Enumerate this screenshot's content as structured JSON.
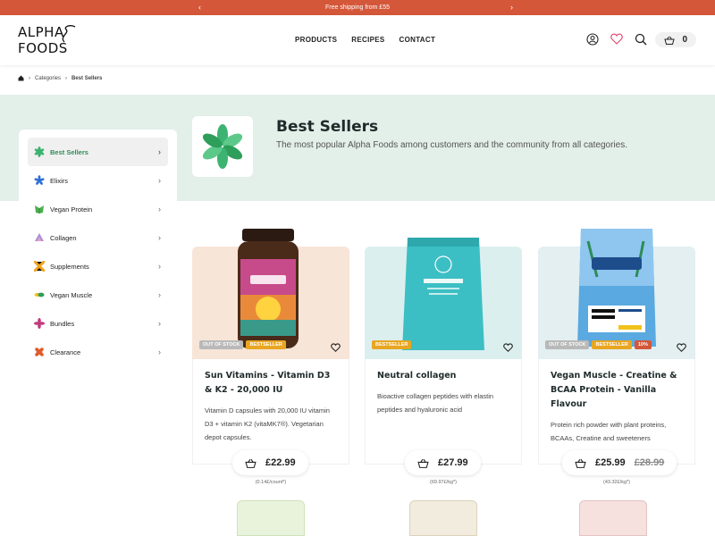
{
  "promo": {
    "text": "Free shipping from £55"
  },
  "brand": {
    "logo_text": "ALPHA FOODS"
  },
  "nav": [
    "PRODUCTS",
    "RECIPES",
    "CONTACT"
  ],
  "cart": {
    "count": "0"
  },
  "breadcrumb": {
    "home_icon": "home-icon",
    "items": [
      "Categories",
      "Best Sellers"
    ]
  },
  "sidebar": {
    "items": [
      {
        "label": "Best Sellers",
        "icon": "best-sellers-icon",
        "color": "#3cb371"
      },
      {
        "label": "Elixirs",
        "icon": "elixirs-icon",
        "color": "#2f6fd6"
      },
      {
        "label": "Vegan Protein",
        "icon": "vegan-protein-icon",
        "color": "#4caf50"
      },
      {
        "label": "Collagen",
        "icon": "collagen-icon",
        "color": "#8e7cc3"
      },
      {
        "label": "Supplements",
        "icon": "supplements-icon",
        "color": "#f2a31b"
      },
      {
        "label": "Vegan Muscle",
        "icon": "vegan-muscle-icon",
        "color": "#2e9e5b"
      },
      {
        "label": "Bundles",
        "icon": "bundles-icon",
        "color": "#c0397a"
      },
      {
        "label": "Clearance",
        "icon": "clearance-icon",
        "color": "#e05a2b"
      }
    ]
  },
  "category": {
    "title": "Best Sellers",
    "description": "The most popular Alpha Foods among customers and the community from all categories."
  },
  "products": [
    {
      "name": "Sun Vitamins - Vitamin D3 & K2 - 20,000 IU",
      "description": "Vitamin D capsules with 20,000 IU vitamin D3 + vitamin K2 (vitaMK7®). Vegetarian depot capsules.",
      "badges": [
        "OUT OF STOCK",
        "BESTSELLER"
      ],
      "price": "£22.99",
      "old_price": "",
      "unit_price": "(0.14£/count*)",
      "bg": "#f7e5d8"
    },
    {
      "name": "Neutral collagen",
      "description": "Bioactive collagen peptides with elastin peptides and hyaluronic acid",
      "badges": [
        "BESTSELLER"
      ],
      "price": "£27.99",
      "old_price": "",
      "unit_price": "(69.97£/kg*)",
      "bg": "#dcefef"
    },
    {
      "name": "Vegan Muscle - Creatine & BCAA Protein - Vanilla Flavour",
      "description": "Protein rich powder with plant proteins, BCAAs, Creatine and sweeteners",
      "badges": [
        "OUT OF STOCK",
        "BESTSELLER",
        "10%"
      ],
      "price": "£25.99",
      "old_price": "£28.99",
      "unit_price": "(43.32£/kg*)",
      "bg": "#e3eff1"
    }
  ],
  "colors": {
    "accent": "#d4573a",
    "band": "#e3efe9",
    "green": "#2e8b57",
    "badge_best": "#e8a622"
  }
}
